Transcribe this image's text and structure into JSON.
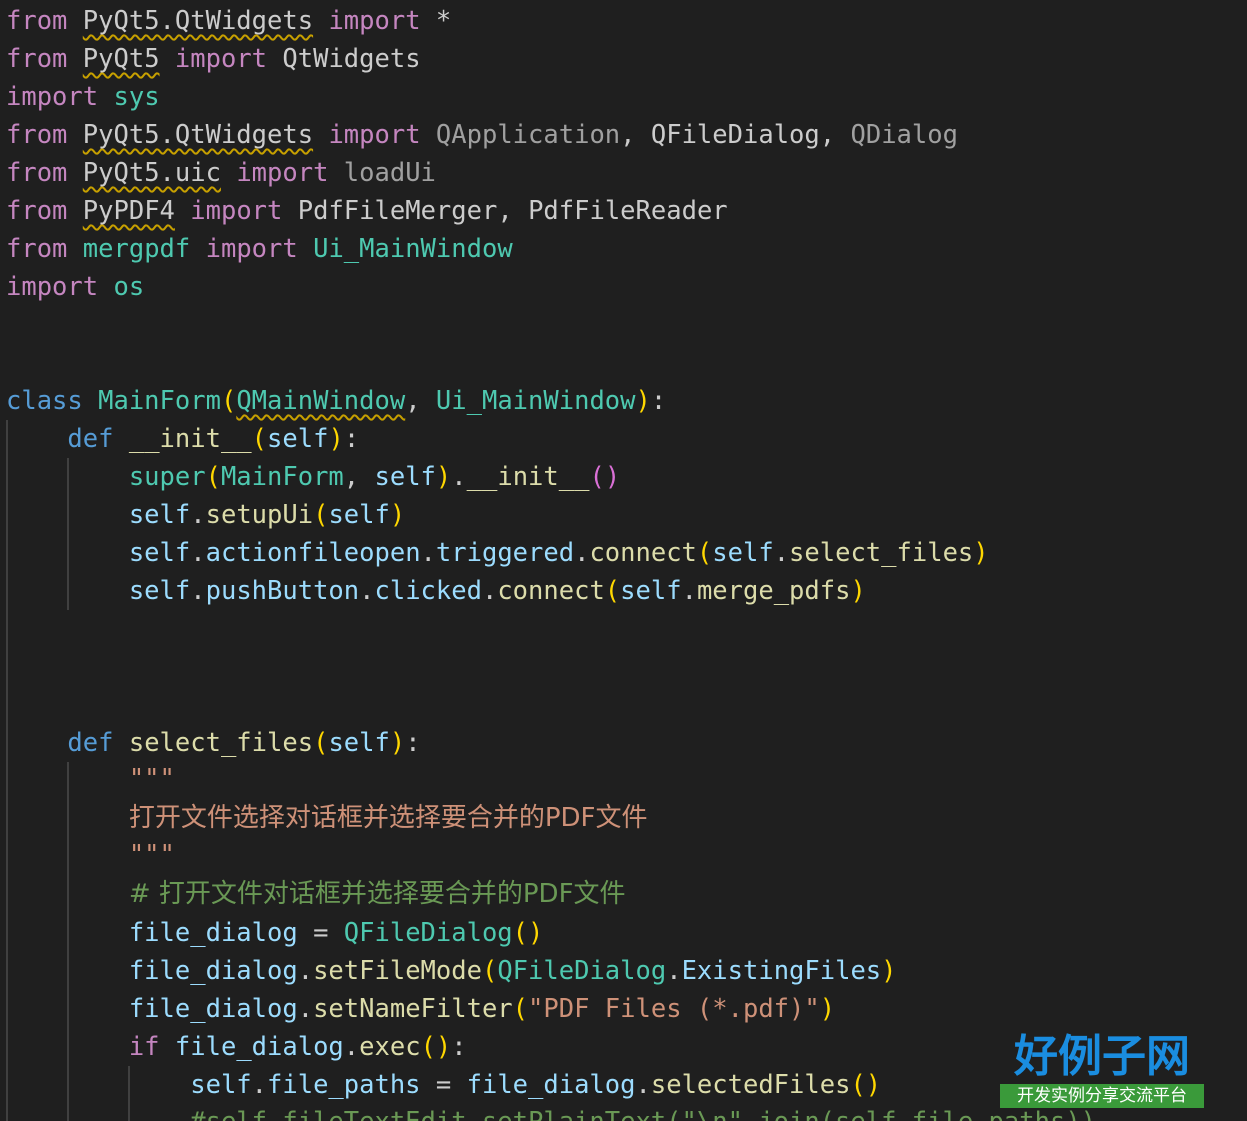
{
  "code": {
    "l1": {
      "a": "from",
      "b": "PyQt5.QtWidgets",
      "c": "import",
      "d": "*"
    },
    "l2": {
      "a": "from",
      "b": "PyQt5",
      "c": "import",
      "d": "QtWidgets"
    },
    "l3": {
      "a": "import",
      "b": "sys"
    },
    "l4": {
      "a": "from",
      "b": "PyQt5.QtWidgets",
      "c": "import",
      "d": "QApplication",
      "e": "QFileDialog",
      "f": "QDialog"
    },
    "l5": {
      "a": "from",
      "b": "PyQt5.uic",
      "c": "import",
      "d": "loadUi"
    },
    "l6": {
      "a": "from",
      "b": "PyPDF4",
      "c": "import",
      "d": "PdfFileMerger",
      "e": "PdfFileReader"
    },
    "l7": {
      "a": "from",
      "b": "mergpdf",
      "c": "import",
      "d": "Ui_MainWindow"
    },
    "l8": {
      "a": "import",
      "b": "os"
    },
    "l9": {
      "a": "class",
      "b": "MainForm",
      "c": "QMainWindow",
      "d": "Ui_MainWindow"
    },
    "l10": {
      "a": "def",
      "b": "__init__",
      "c": "self"
    },
    "l11": {
      "a": "super",
      "b": "MainForm",
      "c": "self",
      "d": "__init__"
    },
    "l12": {
      "a": "self",
      "b": "setupUi",
      "c": "self"
    },
    "l13": {
      "a": "self",
      "b": "actionfileopen",
      "c": "triggered",
      "d": "connect",
      "e": "self",
      "f": "select_files"
    },
    "l14": {
      "a": "self",
      "b": "pushButton",
      "c": "clicked",
      "d": "connect",
      "e": "self",
      "f": "merge_pdfs"
    },
    "l15": {
      "a": "def",
      "b": "select_files",
      "c": "self"
    },
    "l16": {
      "a": "\"\"\""
    },
    "l17": {
      "a": "打开文件选择对话框并选择要合并的PDF文件"
    },
    "l18": {
      "a": "\"\"\""
    },
    "l19": {
      "a": "# 打开文件对话框并选择要合并的PDF文件"
    },
    "l20": {
      "a": "file_dialog",
      "b": "QFileDialog"
    },
    "l21": {
      "a": "file_dialog",
      "b": "setFileMode",
      "c": "QFileDialog",
      "d": "ExistingFiles"
    },
    "l22": {
      "a": "file_dialog",
      "b": "setNameFilter",
      "c": "\"PDF Files (*.pdf)\""
    },
    "l23": {
      "a": "if",
      "b": "file_dialog",
      "c": "exec"
    },
    "l24": {
      "a": "self",
      "b": "file_paths",
      "c": "file_dialog",
      "d": "selectedFiles"
    },
    "l25": {
      "a": "#self.fileTextEdit.setPlainText(\"\\n\".join(self.file_paths))"
    }
  },
  "watermark": {
    "title": "好例子网",
    "subtitle": "开发实例分享交流平台"
  },
  "colors": {
    "background": "#1f1f1f",
    "keyword": "#c586c0",
    "storage": "#569cd6",
    "class": "#4ec9b0",
    "function": "#dcdcaa",
    "variable": "#9cdcfe",
    "string": "#ce9178",
    "comment": "#6a9955"
  }
}
